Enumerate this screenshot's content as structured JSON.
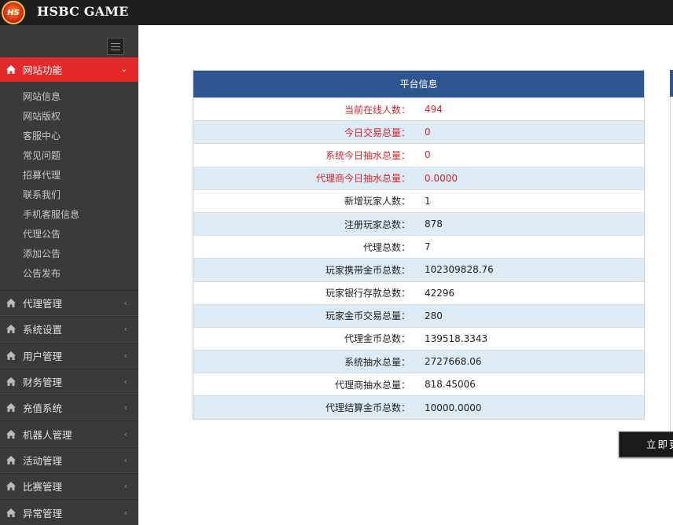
{
  "header": {
    "logo_text": "HS",
    "brand": "HSBC GAME"
  },
  "sidebar": {
    "active": {
      "label": "网站功能",
      "icon": "home-icon"
    },
    "submenu": [
      "网站信息",
      "网站版权",
      "客服中心",
      "常见问题",
      "招募代理",
      "联系我们",
      "手机客服信息",
      "代理公告",
      "添加公告",
      "公告发布"
    ],
    "menu": [
      "代理管理",
      "系统设置",
      "用户管理",
      "财务管理",
      "充值系统",
      "机器人管理",
      "活动管理",
      "比赛管理",
      "异常管理"
    ]
  },
  "main": {
    "panel_title": "平台信息",
    "rows": [
      {
        "label": "当前在线人数：",
        "value": "494",
        "highlight": true
      },
      {
        "label": "今日交易总量：",
        "value": "0",
        "highlight": true
      },
      {
        "label": "系统今日抽水总量：",
        "value": "0",
        "highlight": true
      },
      {
        "label": "代理商今日抽水总量：",
        "value": "0.0000",
        "highlight": true
      },
      {
        "label": "新增玩家人数：",
        "value": "1",
        "highlight": false
      },
      {
        "label": "注册玩家总数：",
        "value": "878",
        "highlight": false
      },
      {
        "label": "代理总数：",
        "value": "7",
        "highlight": false
      },
      {
        "label": "玩家携带金币总数：",
        "value": "102309828.76",
        "highlight": false
      },
      {
        "label": "玩家银行存款总数：",
        "value": "42296",
        "highlight": false
      },
      {
        "label": "玩家金币交易总量：",
        "value": "280",
        "highlight": false
      },
      {
        "label": "代理金币总数：",
        "value": "139518.3343",
        "highlight": false
      },
      {
        "label": "系统抽水总量：",
        "value": "2727668.06",
        "highlight": false
      },
      {
        "label": "代理商抽水总量：",
        "value": "818.45006",
        "highlight": false
      },
      {
        "label": "代理结算金币总数：",
        "value": "10000.0000",
        "highlight": false
      }
    ],
    "action_button": "立即更"
  },
  "colors": {
    "topbar": "#1e1e1e",
    "sidebar": "#3a3a3a",
    "active_menu": "#e4292a",
    "panel_header": "#2e5590",
    "row_alt": "#dcebf5",
    "highlight_text": "#d8232a"
  }
}
